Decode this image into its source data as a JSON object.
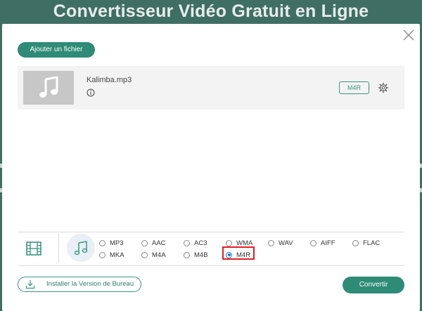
{
  "page": {
    "background_title": "Convertisseur Vidéo Gratuit en Ligne"
  },
  "toolbar": {
    "add_file_label": "Ajouter un fichier"
  },
  "file": {
    "name": "Kalimba.mp3",
    "format_badge": "M4R"
  },
  "formats": {
    "row1": [
      "MP3",
      "AAC",
      "AC3",
      "WMA",
      "WAV",
      "AIFF",
      "FLAC"
    ],
    "row2": [
      "MKA",
      "M4A",
      "M4B",
      "M4R"
    ],
    "selected": "M4R"
  },
  "footer": {
    "install_label": "Installer la Version de Bureau",
    "convert_label": "Convertir"
  },
  "colors": {
    "accent": "#2e8b76",
    "highlight": "#e02020",
    "radio_selected": "#1a73e8"
  }
}
